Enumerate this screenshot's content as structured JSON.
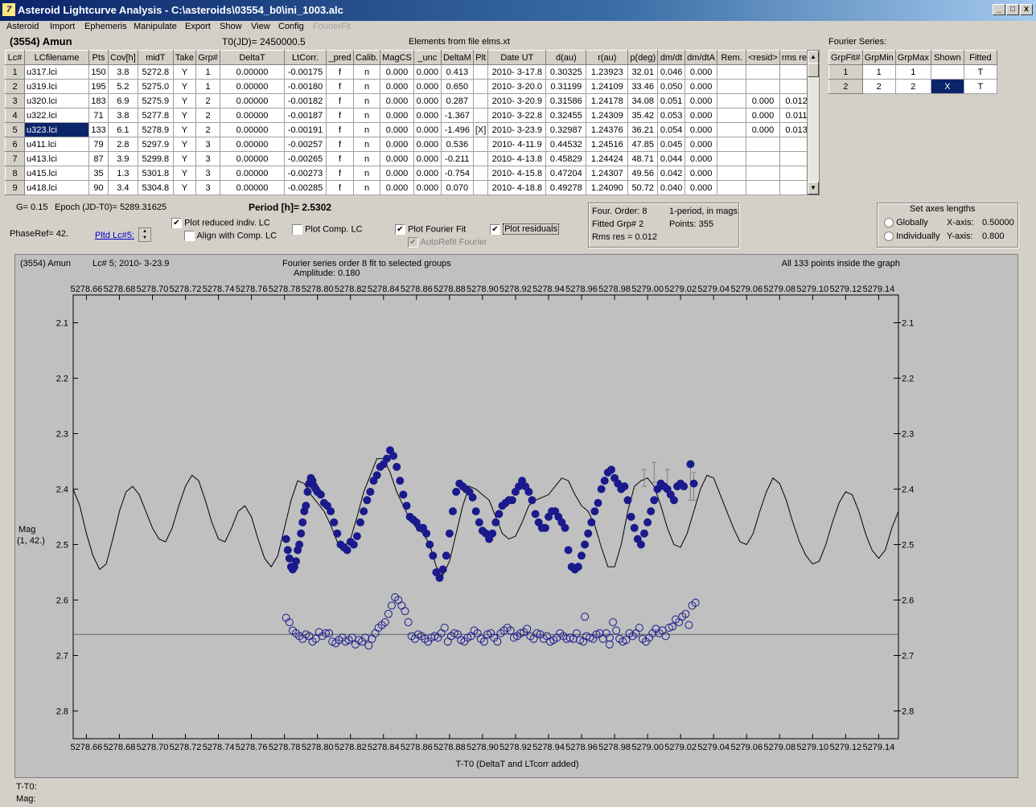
{
  "window": {
    "title": "Asteroid Lightcurve Analysis - C:\\asteroids\\03554_b0\\ini_1003.alc",
    "min": "_",
    "restore": "□",
    "close": "x",
    "app_icon": "7"
  },
  "menu": [
    "Asteroid",
    "Import",
    "Ephemeris",
    "Manipulate",
    "Export",
    "Show",
    "View",
    "Config",
    "FourierFit"
  ],
  "header": {
    "asteroid": "(3554) Amun",
    "t0": "T0(JD)= 2450000.5",
    "elements": "Elements from file elms.xt"
  },
  "lc_table": {
    "columns": [
      "Lc#",
      "LCfilename",
      "Pts",
      "Cov[h]",
      "midT",
      "Take",
      "Grp#",
      "DeltaT",
      "LtCorr.",
      "_pred",
      "Calib.",
      "MagCS",
      "_unc",
      "DeltaM",
      "Plt",
      "Date UT",
      "d(au)",
      "r(au)",
      "p(deg)",
      "dm/dt",
      "dm/dtA",
      "Rem.",
      "<resid>",
      "rms res"
    ],
    "rows": [
      [
        "1",
        "u317.lci",
        "150",
        "3.8",
        "5272.8",
        "Y",
        "1",
        "0.00000",
        "-0.00175",
        "f",
        "n",
        "0.000",
        "0.000",
        "0.413",
        "",
        "2010- 3-17.8",
        "0.30325",
        "1.23923",
        "32.01",
        "0.046",
        "0.000",
        "",
        "",
        ""
      ],
      [
        "2",
        "u319.lci",
        "195",
        "5.2",
        "5275.0",
        "Y",
        "1",
        "0.00000",
        "-0.00180",
        "f",
        "n",
        "0.000",
        "0.000",
        "0.650",
        "",
        "2010- 3-20.0",
        "0.31199",
        "1.24109",
        "33.46",
        "0.050",
        "0.000",
        "",
        "",
        ""
      ],
      [
        "3",
        "u320.lci",
        "183",
        "6.9",
        "5275.9",
        "Y",
        "2",
        "0.00000",
        "-0.00182",
        "f",
        "n",
        "0.000",
        "0.000",
        "0.287",
        "",
        "2010- 3-20.9",
        "0.31586",
        "1.24178",
        "34.08",
        "0.051",
        "0.000",
        "",
        "0.000",
        "0.012"
      ],
      [
        "4",
        "u322.lci",
        "71",
        "3.8",
        "5277.8",
        "Y",
        "2",
        "0.00000",
        "-0.00187",
        "f",
        "n",
        "0.000",
        "0.000",
        "-1.367",
        "",
        "2010- 3-22.8",
        "0.32455",
        "1.24309",
        "35.42",
        "0.053",
        "0.000",
        "",
        "0.000",
        "0.011"
      ],
      [
        "5",
        "u323.lci",
        "133",
        "6.1",
        "5278.9",
        "Y",
        "2",
        "0.00000",
        "-0.00191",
        "f",
        "n",
        "0.000",
        "0.000",
        "-1.496",
        "[X]",
        "2010- 3-23.9",
        "0.32987",
        "1.24376",
        "36.21",
        "0.054",
        "0.000",
        "",
        "0.000",
        "0.013"
      ],
      [
        "6",
        "u411.lci",
        "79",
        "2.8",
        "5297.9",
        "Y",
        "3",
        "0.00000",
        "-0.00257",
        "f",
        "n",
        "0.000",
        "0.000",
        "0.536",
        "",
        "2010- 4-11.9",
        "0.44532",
        "1.24516",
        "47.85",
        "0.045",
        "0.000",
        "",
        "",
        ""
      ],
      [
        "7",
        "u413.lci",
        "87",
        "3.9",
        "5299.8",
        "Y",
        "3",
        "0.00000",
        "-0.00265",
        "f",
        "n",
        "0.000",
        "0.000",
        "-0.211",
        "",
        "2010- 4-13.8",
        "0.45829",
        "1.24424",
        "48.71",
        "0.044",
        "0.000",
        "",
        "",
        ""
      ],
      [
        "8",
        "u415.lci",
        "35",
        "1.3",
        "5301.8",
        "Y",
        "3",
        "0.00000",
        "-0.00273",
        "f",
        "n",
        "0.000",
        "0.000",
        "-0.754",
        "",
        "2010- 4-15.8",
        "0.47204",
        "1.24307",
        "49.56",
        "0.042",
        "0.000",
        "",
        "",
        ""
      ],
      [
        "9",
        "u418.lci",
        "90",
        "3.4",
        "5304.8",
        "Y",
        "3",
        "0.00000",
        "-0.00285",
        "f",
        "n",
        "0.000",
        "0.000",
        "0.070",
        "",
        "2010- 4-18.8",
        "0.49278",
        "1.24090",
        "50.72",
        "0.040",
        "0.000",
        "",
        "",
        ""
      ]
    ],
    "selected_row": 4
  },
  "fourier_table": {
    "title": "Fourier Series:",
    "columns": [
      "GrpFit#",
      "GrpMin",
      "GrpMax",
      "Shown",
      "Fitted"
    ],
    "rows": [
      [
        "1",
        "1",
        "1",
        "",
        "T"
      ],
      [
        "2",
        "2",
        "2",
        "X",
        "T"
      ]
    ]
  },
  "controls": {
    "g_param": "G= 0.15",
    "epoch": "Epoch (JD-T0)= 5289.31625",
    "period_label": "Period [h]=",
    "period_value": "2.5302",
    "phase_ref": "PhaseRef= 42.",
    "pltd_lc": "Pltd Lc#5:",
    "plot_reduced": "Plot reduced indiv. LC",
    "align_comp": "Align with Comp. LC",
    "plot_comp": "Plot Comp. LC",
    "plot_fourier": "Plot Fourier Fit",
    "autorefit": "AutoRefit Fourier",
    "plot_residuals": "Plot residuals",
    "info_order": "Four. Order:  8",
    "info_period": "1-period, in mags",
    "info_grp": "Fitted Grp# 2",
    "info_points": "Points: 355",
    "info_rms": "Rms res     = 0.012",
    "axes_title": "Set axes lengths",
    "globally": "Globally",
    "individually": "Individually",
    "xaxis_label": "X-axis:",
    "xaxis_val": "0.50000",
    "yaxis_label": "Y-axis:",
    "yaxis_val": "0.800",
    "check_mark": "✔"
  },
  "status": {
    "tt0": "T-T0:",
    "mag": "Mag:"
  },
  "chart_data": {
    "type": "scatter",
    "title_left": "(3554) Amun",
    "title_lc": "Lc# 5; 2010- 3-23.9",
    "title_center": "Fourier series order 8 fit to selected groups",
    "amplitude": "Amplitude: 0.180",
    "title_right": "All 133 points inside the graph",
    "xlabel": "T-T0 (DeltaT and LTcorr added)",
    "ylabel": "Mag",
    "ylabel2": "(1, 42.)",
    "xlim": [
      5278.652,
      5279.152
    ],
    "ylim": [
      2.05,
      2.85
    ],
    "y_inverted": true,
    "xticks": [
      "5278.66",
      "5278.68",
      "5278.70",
      "5278.72",
      "5278.74",
      "5278.76",
      "5278.78",
      "5278.80",
      "5278.82",
      "5278.84",
      "5278.86",
      "5278.88",
      "5278.90",
      "5278.92",
      "5278.94",
      "5278.96",
      "5278.98",
      "5279.00",
      "5279.02",
      "5279.04",
      "5279.06",
      "5279.08",
      "5279.10",
      "5279.12",
      "5279.14"
    ],
    "yticks": [
      "2.1",
      "2.2",
      "2.3",
      "2.4",
      "2.5",
      "2.6",
      "2.7",
      "2.8"
    ],
    "residual_baseline": 2.662,
    "fit_curve": {
      "x": [
        5278.652,
        5278.656,
        5278.66,
        5278.664,
        5278.668,
        5278.672,
        5278.676,
        5278.68,
        5278.684,
        5278.688,
        5278.692,
        5278.696,
        5278.7,
        5278.704,
        5278.708,
        5278.712,
        5278.716,
        5278.72,
        5278.724,
        5278.728,
        5278.732,
        5278.736,
        5278.74,
        5278.744,
        5278.748,
        5278.752,
        5278.756,
        5278.76,
        5278.764,
        5278.768,
        5278.772,
        5278.776,
        5278.78,
        5278.784,
        5278.788,
        5278.792,
        5278.796,
        5278.8,
        5278.804,
        5278.808,
        5278.812,
        5278.816,
        5278.82,
        5278.824,
        5278.828,
        5278.832,
        5278.836,
        5278.84,
        5278.844,
        5278.848,
        5278.852,
        5278.856,
        5278.86,
        5278.864,
        5278.868,
        5278.872,
        5278.876,
        5278.88,
        5278.884,
        5278.888,
        5278.892,
        5278.896,
        5278.9,
        5278.904,
        5278.908,
        5278.912,
        5278.916,
        5278.92,
        5278.924,
        5278.928,
        5278.932,
        5278.936,
        5278.94,
        5278.944,
        5278.948,
        5278.952,
        5278.956,
        5278.96,
        5278.964,
        5278.968,
        5278.972,
        5278.976,
        5278.98,
        5278.984,
        5278.988,
        5278.992,
        5278.996,
        5279.0,
        5279.004,
        5279.008,
        5279.012,
        5279.016,
        5279.02,
        5279.024,
        5279.028,
        5279.032,
        5279.036,
        5279.04,
        5279.044,
        5279.048,
        5279.052,
        5279.056,
        5279.06,
        5279.064,
        5279.068,
        5279.072,
        5279.076,
        5279.08,
        5279.084,
        5279.088,
        5279.092,
        5279.096,
        5279.1,
        5279.104,
        5279.108,
        5279.112,
        5279.116,
        5279.12,
        5279.124,
        5279.128,
        5279.132,
        5279.136,
        5279.14,
        5279.144,
        5279.148,
        5279.152
      ],
      "y": [
        2.4,
        2.43,
        2.48,
        2.52,
        2.545,
        2.535,
        2.49,
        2.44,
        2.405,
        2.395,
        2.41,
        2.44,
        2.47,
        2.49,
        2.495,
        2.47,
        2.43,
        2.395,
        2.375,
        2.385,
        2.42,
        2.46,
        2.49,
        2.495,
        2.47,
        2.44,
        2.43,
        2.45,
        2.49,
        2.525,
        2.54,
        2.52,
        2.47,
        2.42,
        2.385,
        2.39,
        2.41,
        2.425,
        2.44,
        2.465,
        2.495,
        2.505,
        2.49,
        2.45,
        2.405,
        2.375,
        2.345,
        2.345,
        2.37,
        2.405,
        2.43,
        2.455,
        2.47,
        2.48,
        2.5,
        2.54,
        2.555,
        2.53,
        2.48,
        2.43,
        2.395,
        2.4,
        2.41,
        2.42,
        2.45,
        2.48,
        2.49,
        2.485,
        2.46,
        2.43,
        2.42,
        2.415,
        2.41,
        2.395,
        2.38,
        2.385,
        2.41,
        2.43,
        2.44,
        2.465,
        2.505,
        2.54,
        2.54,
        2.5,
        2.44,
        2.395,
        2.385,
        2.38,
        2.395,
        2.43,
        2.47,
        2.5,
        2.505,
        2.48,
        2.44,
        2.4,
        2.375,
        2.38,
        2.41,
        2.44,
        2.47,
        2.495,
        2.5,
        2.48,
        2.44,
        2.405,
        2.38,
        2.39,
        2.42,
        2.46,
        2.495,
        2.52,
        2.535,
        2.53,
        2.5,
        2.46,
        2.425,
        2.405,
        2.41,
        2.44,
        2.48,
        2.51,
        2.525,
        2.51,
        2.47,
        2.44
      ]
    },
    "data_points": {
      "x": [
        5278.781,
        5278.782,
        5278.783,
        5278.784,
        5278.785,
        5278.786,
        5278.787,
        5278.788,
        5278.789,
        5278.79,
        5278.791,
        5278.792,
        5278.793,
        5278.794,
        5278.795,
        5278.796,
        5278.797,
        5278.798,
        5278.799,
        5278.8,
        5278.802,
        5278.804,
        5278.806,
        5278.808,
        5278.81,
        5278.812,
        5278.814,
        5278.816,
        5278.818,
        5278.82,
        5278.822,
        5278.824,
        5278.826,
        5278.828,
        5278.83,
        5278.832,
        5278.834,
        5278.836,
        5278.838,
        5278.84,
        5278.842,
        5278.844,
        5278.846,
        5278.848,
        5278.85,
        5278.852,
        5278.854,
        5278.856,
        5278.858,
        5278.86,
        5278.862,
        5278.864,
        5278.866,
        5278.868,
        5278.87,
        5278.872,
        5278.874,
        5278.876,
        5278.878,
        5278.88,
        5278.882,
        5278.884,
        5278.886,
        5278.888,
        5278.89,
        5278.892,
        5278.894,
        5278.896,
        5278.898,
        5278.9,
        5278.902,
        5278.904,
        5278.906,
        5278.908,
        5278.91,
        5278.912,
        5278.914,
        5278.916,
        5278.918,
        5278.92,
        5278.922,
        5278.924,
        5278.926,
        5278.928,
        5278.93,
        5278.932,
        5278.934,
        5278.936,
        5278.938,
        5278.94,
        5278.942,
        5278.944,
        5278.946,
        5278.948,
        5278.95,
        5278.952,
        5278.954,
        5278.956,
        5278.958,
        5278.96,
        5278.962,
        5278.964,
        5278.966,
        5278.968,
        5278.97,
        5278.972,
        5278.974,
        5278.976,
        5278.978,
        5278.98,
        5278.982,
        5278.984,
        5278.986,
        5278.988,
        5278.99,
        5278.992,
        5278.994,
        5278.996,
        5278.998,
        5279.0,
        5279.002,
        5279.004,
        5279.006,
        5279.008,
        5279.01,
        5279.012,
        5279.014,
        5279.016,
        5279.018,
        5279.02,
        5279.022,
        5279.026,
        5279.028
      ],
      "y": [
        2.49,
        2.51,
        2.525,
        2.54,
        2.545,
        2.54,
        2.53,
        2.51,
        2.5,
        2.48,
        2.46,
        2.44,
        2.43,
        2.405,
        2.39,
        2.38,
        2.385,
        2.395,
        2.4,
        2.405,
        2.41,
        2.425,
        2.43,
        2.44,
        2.46,
        2.48,
        2.5,
        2.505,
        2.51,
        2.495,
        2.5,
        2.485,
        2.46,
        2.44,
        2.42,
        2.405,
        2.385,
        2.375,
        2.36,
        2.355,
        2.345,
        2.33,
        2.34,
        2.36,
        2.385,
        2.41,
        2.43,
        2.45,
        2.455,
        2.46,
        2.47,
        2.47,
        2.48,
        2.5,
        2.52,
        2.55,
        2.56,
        2.545,
        2.52,
        2.48,
        2.44,
        2.405,
        2.39,
        2.395,
        2.4,
        2.405,
        2.415,
        2.44,
        2.46,
        2.475,
        2.48,
        2.49,
        2.48,
        2.46,
        2.445,
        2.43,
        2.425,
        2.42,
        2.42,
        2.405,
        2.395,
        2.385,
        2.395,
        2.405,
        2.42,
        2.445,
        2.46,
        2.47,
        2.47,
        2.45,
        2.44,
        2.44,
        2.45,
        2.46,
        2.47,
        2.51,
        2.54,
        2.545,
        2.54,
        2.52,
        2.5,
        2.48,
        2.46,
        2.44,
        2.425,
        2.4,
        2.385,
        2.37,
        2.365,
        2.38,
        2.39,
        2.4,
        2.395,
        2.42,
        2.45,
        2.47,
        2.49,
        2.5,
        2.48,
        2.46,
        2.44,
        2.42,
        2.4,
        2.39,
        2.395,
        2.4,
        2.41,
        2.42,
        2.395,
        2.39,
        2.395,
        2.355,
        2.39
      ],
      "err_x": [
        5278.998,
        5279.004,
        5279.012,
        5279.026,
        5279.028
      ],
      "err_y": [
        2.38,
        2.37,
        2.385,
        2.39,
        2.395
      ],
      "err_size": [
        0.015,
        0.018,
        0.02,
        0.03,
        0.025
      ]
    },
    "residual_points": {
      "x": [
        5278.781,
        5278.783,
        5278.785,
        5278.787,
        5278.789,
        5278.791,
        5278.793,
        5278.795,
        5278.797,
        5278.799,
        5278.801,
        5278.803,
        5278.805,
        5278.807,
        5278.809,
        5278.811,
        5278.813,
        5278.815,
        5278.817,
        5278.819,
        5278.821,
        5278.823,
        5278.825,
        5278.827,
        5278.829,
        5278.831,
        5278.833,
        5278.835,
        5278.837,
        5278.839,
        5278.841,
        5278.843,
        5278.845,
        5278.847,
        5278.849,
        5278.851,
        5278.853,
        5278.855,
        5278.857,
        5278.859,
        5278.861,
        5278.863,
        5278.865,
        5278.867,
        5278.869,
        5278.871,
        5278.873,
        5278.875,
        5278.877,
        5278.879,
        5278.881,
        5278.883,
        5278.885,
        5278.887,
        5278.889,
        5278.891,
        5278.893,
        5278.895,
        5278.897,
        5278.899,
        5278.901,
        5278.903,
        5278.905,
        5278.907,
        5278.909,
        5278.911,
        5278.913,
        5278.915,
        5278.917,
        5278.919,
        5278.921,
        5278.923,
        5278.925,
        5278.927,
        5278.929,
        5278.931,
        5278.933,
        5278.935,
        5278.937,
        5278.939,
        5278.941,
        5278.943,
        5278.945,
        5278.947,
        5278.949,
        5278.951,
        5278.953,
        5278.955,
        5278.957,
        5278.959,
        5278.961,
        5278.963,
        5278.965,
        5278.967,
        5278.969,
        5278.971,
        5278.973,
        5278.975,
        5278.977,
        5278.979,
        5278.981,
        5278.983,
        5278.985,
        5278.987,
        5278.989,
        5278.991,
        5278.993,
        5278.995,
        5278.997,
        5278.999,
        5279.001,
        5279.003,
        5279.005,
        5279.007,
        5279.009,
        5279.011,
        5279.013,
        5279.015,
        5279.017,
        5279.019,
        5279.021,
        5279.023,
        5279.025,
        5279.027,
        5279.029,
        5278.962,
        5278.977
      ],
      "y": [
        2.632,
        2.64,
        2.655,
        2.66,
        2.665,
        2.67,
        2.662,
        2.665,
        2.675,
        2.67,
        2.658,
        2.665,
        2.66,
        2.66,
        2.675,
        2.678,
        2.672,
        2.668,
        2.675,
        2.672,
        2.668,
        2.68,
        2.672,
        2.675,
        2.668,
        2.682,
        2.67,
        2.66,
        2.65,
        2.645,
        2.64,
        2.625,
        2.61,
        2.595,
        2.6,
        2.61,
        2.62,
        2.64,
        2.665,
        2.67,
        2.662,
        2.665,
        2.67,
        2.675,
        2.668,
        2.665,
        2.668,
        2.66,
        2.65,
        2.675,
        2.665,
        2.66,
        2.662,
        2.672,
        2.675,
        2.668,
        2.665,
        2.655,
        2.66,
        2.67,
        2.675,
        2.662,
        2.66,
        2.668,
        2.675,
        2.66,
        2.655,
        2.65,
        2.655,
        2.668,
        2.665,
        2.66,
        2.658,
        2.652,
        2.665,
        2.67,
        2.66,
        2.662,
        2.67,
        2.665,
        2.675,
        2.672,
        2.668,
        2.66,
        2.665,
        2.67,
        2.668,
        2.67,
        2.66,
        2.672,
        2.675,
        2.665,
        2.668,
        2.67,
        2.662,
        2.66,
        2.67,
        2.66,
        2.668,
        2.64,
        2.655,
        2.67,
        2.675,
        2.672,
        2.66,
        2.665,
        2.66,
        2.65,
        2.67,
        2.675,
        2.668,
        2.66,
        2.652,
        2.66,
        2.655,
        2.665,
        2.65,
        2.648,
        2.635,
        2.64,
        2.63,
        2.625,
        2.645,
        2.61,
        2.605,
        2.63,
        2.68
      ]
    },
    "colors": {
      "points": "#1a1a8c",
      "curve": "#000000",
      "plot_bg": "#c0c0c0"
    }
  }
}
